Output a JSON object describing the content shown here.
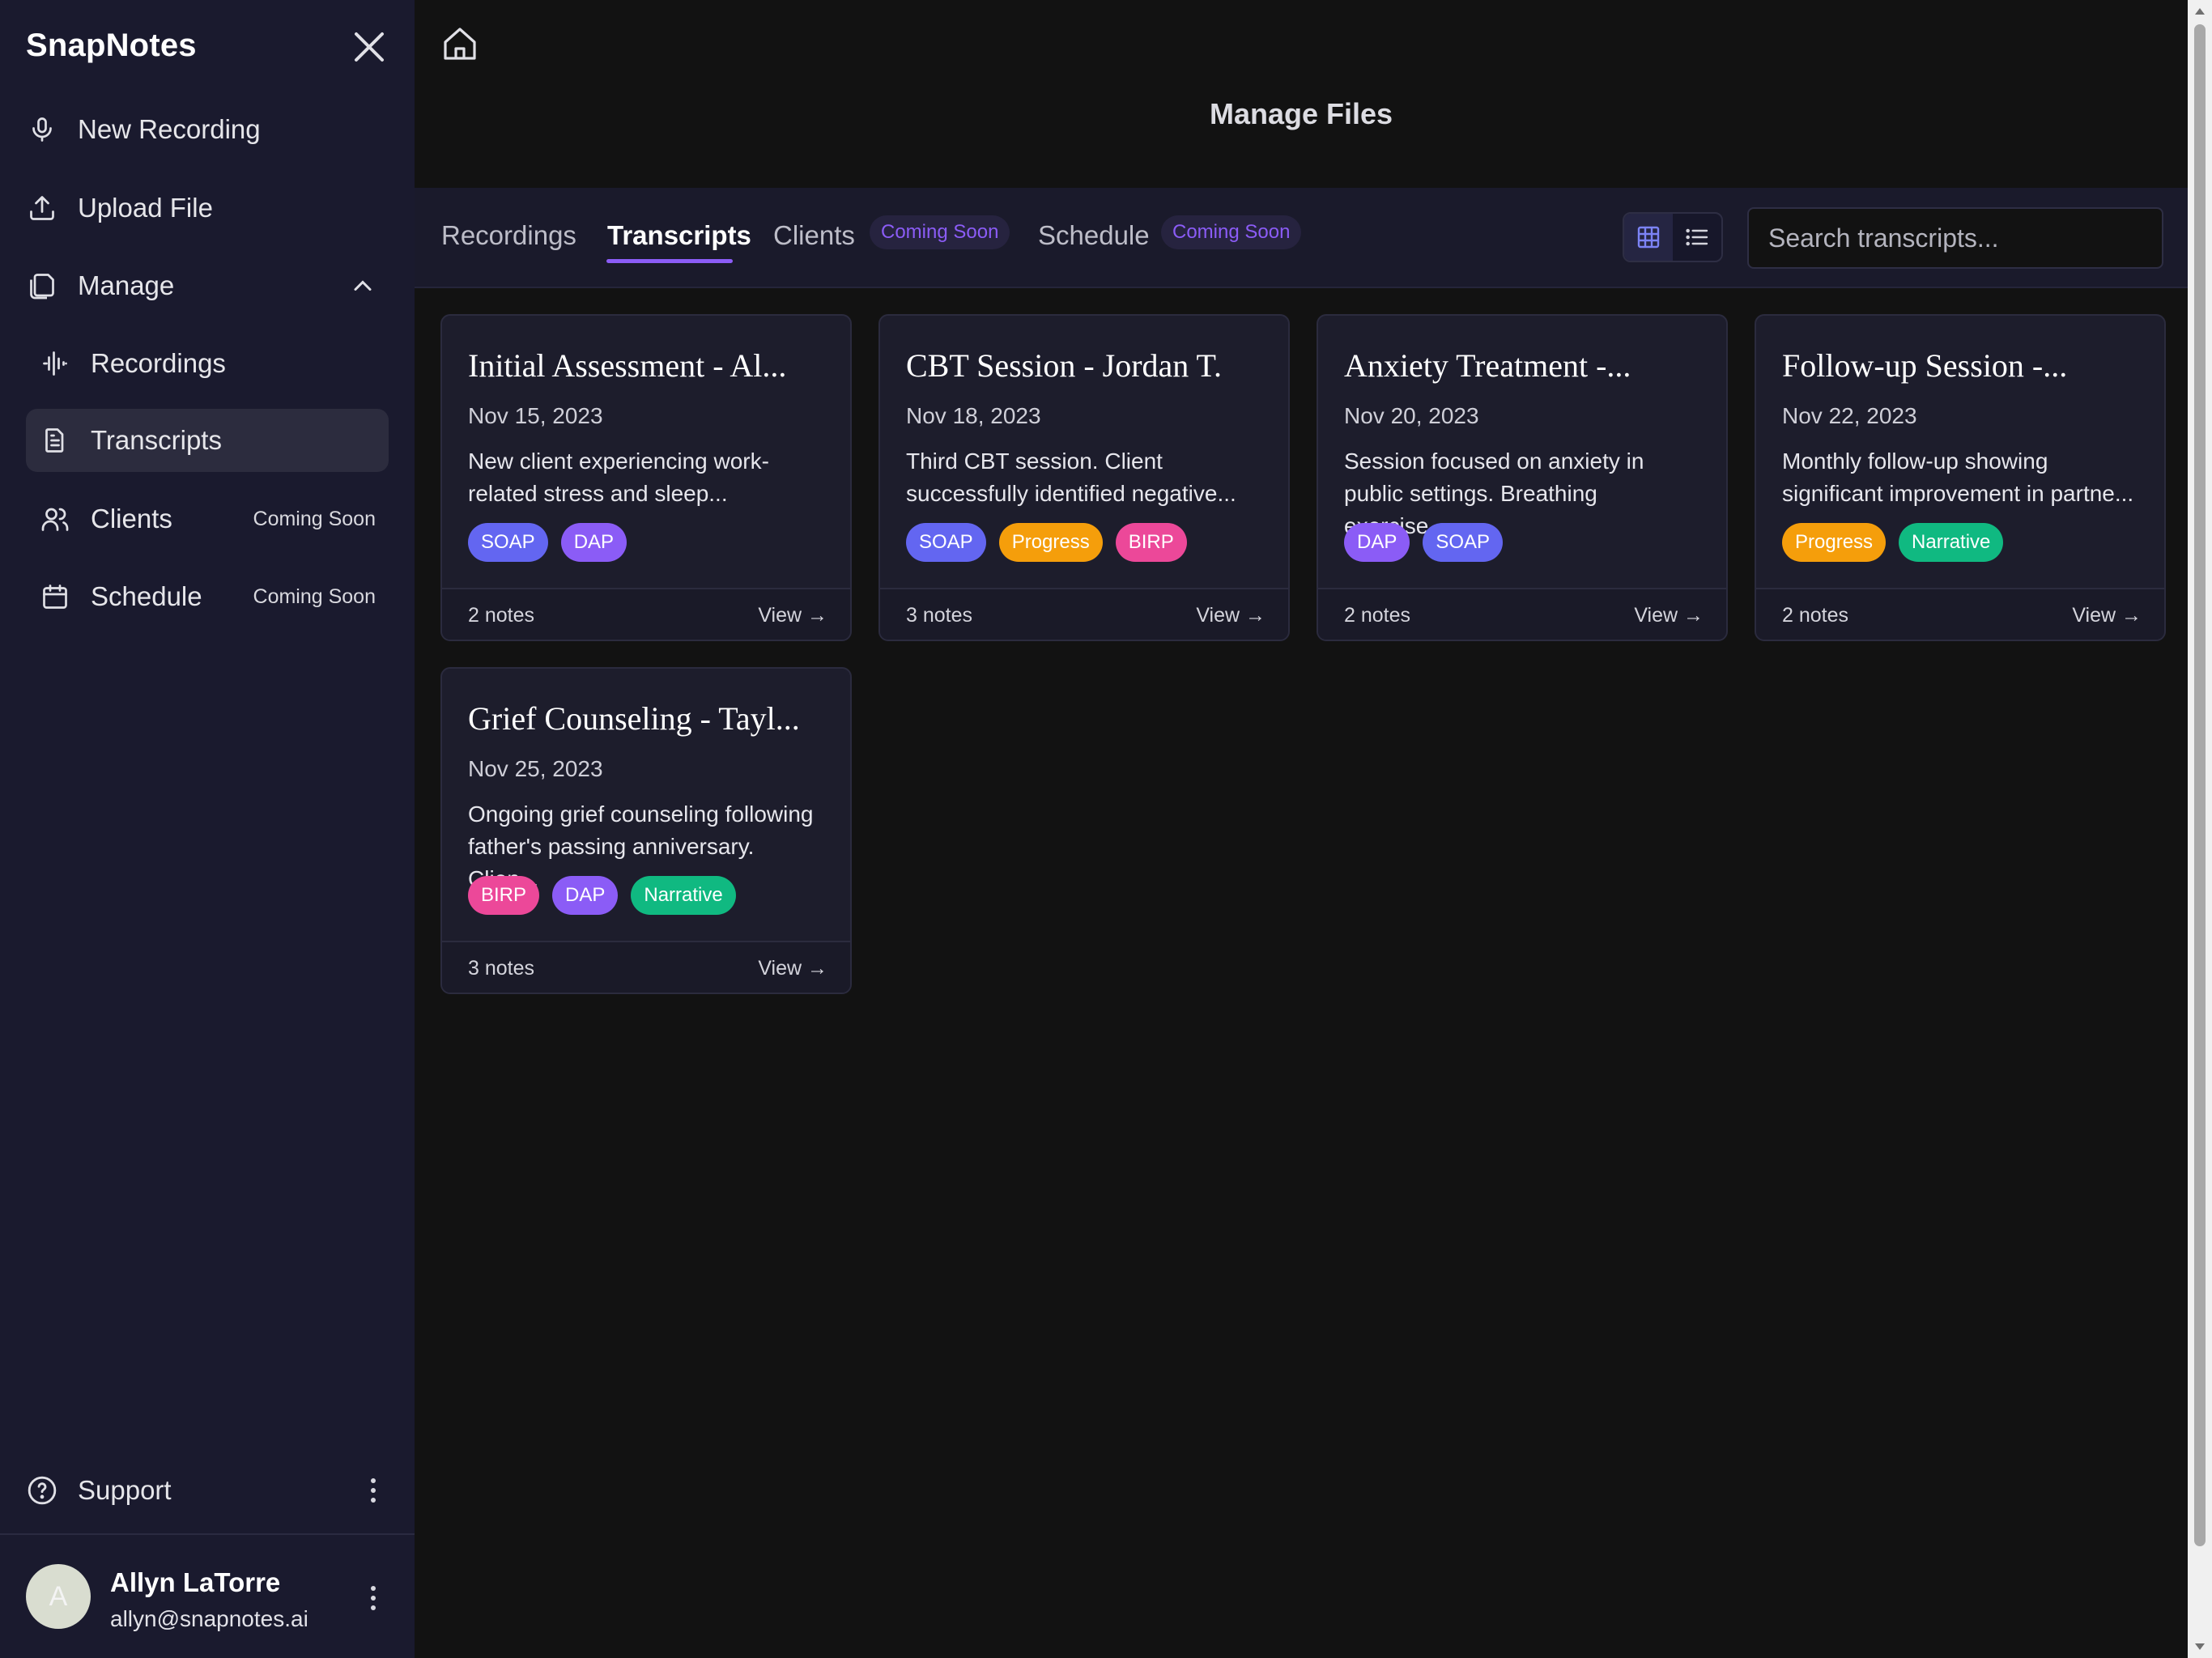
{
  "app": {
    "name": "SnapNotes"
  },
  "sidebar": {
    "items": [
      {
        "label": "New Recording",
        "icon": "microphone-icon"
      },
      {
        "label": "Upload File",
        "icon": "upload-icon"
      },
      {
        "label": "Manage",
        "icon": "files-icon"
      },
      {
        "label": "Recordings",
        "icon": "waveform-icon"
      },
      {
        "label": "Transcripts",
        "icon": "document-icon",
        "active": true
      },
      {
        "label": "Clients",
        "icon": "users-icon",
        "badge": "Coming Soon"
      },
      {
        "label": "Schedule",
        "icon": "calendar-icon",
        "badge": "Coming Soon"
      }
    ],
    "support_label": "Support",
    "user": {
      "initial": "A",
      "name": "Allyn LaTorre",
      "email": "allyn@snapnotes.ai"
    }
  },
  "main": {
    "title": "Manage Files",
    "tabs": [
      {
        "label": "Recordings"
      },
      {
        "label": "Transcripts",
        "active": true
      },
      {
        "label": "Clients",
        "badge": "Coming Soon"
      },
      {
        "label": "Schedule",
        "badge": "Coming Soon"
      }
    ],
    "search": {
      "placeholder": "Search transcripts..."
    },
    "view_mode": "grid"
  },
  "tag_colors": {
    "SOAP": "#6366f1",
    "DAP": "#8b5cf6",
    "Progress": "#f59e0b",
    "BIRP": "#ec4899",
    "Narrative": "#10b981"
  },
  "cards": [
    {
      "title": "Initial Assessment - Al...",
      "date": "Nov 15, 2023",
      "desc": "New client experiencing work-related stress and sleep...",
      "tags": [
        "SOAP",
        "DAP"
      ],
      "notes": "2 notes",
      "view": "View →"
    },
    {
      "title": "CBT Session - Jordan T.",
      "date": "Nov 18, 2023",
      "desc": "Third CBT session. Client successfully identified negative...",
      "tags": [
        "SOAP",
        "Progress",
        "BIRP"
      ],
      "notes": "3 notes",
      "view": "View →"
    },
    {
      "title": "Anxiety Treatment -...",
      "date": "Nov 20, 2023",
      "desc": "Session focused on anxiety in public settings. Breathing exercise...",
      "tags": [
        "DAP",
        "SOAP"
      ],
      "notes": "2 notes",
      "view": "View →"
    },
    {
      "title": "Follow-up Session -...",
      "date": "Nov 22, 2023",
      "desc": "Monthly follow-up showing significant improvement in partne...",
      "tags": [
        "Progress",
        "Narrative"
      ],
      "notes": "2 notes",
      "view": "View →"
    },
    {
      "title": "Grief Counseling - Tayl...",
      "date": "Nov 25, 2023",
      "desc": "Ongoing grief counseling following father's passing anniversary. Clien...",
      "tags": [
        "BIRP",
        "DAP",
        "Narrative"
      ],
      "notes": "3 notes",
      "view": "View →"
    }
  ]
}
